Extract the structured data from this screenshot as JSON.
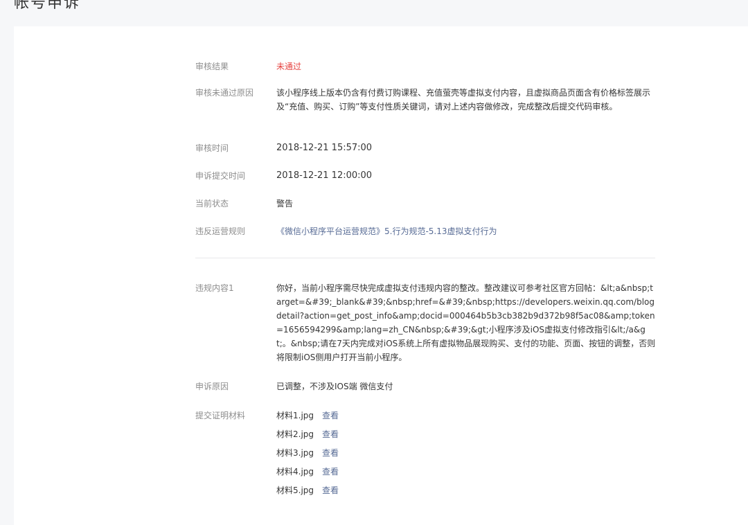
{
  "page": {
    "title": "帐号申诉"
  },
  "review": {
    "result": {
      "label": "审核结果",
      "value": "未通过"
    },
    "reason": {
      "label": "审核未通过原因",
      "value": "该小程序线上版本仍含有付费订购课程、充值萤壳等虚拟支付内容，且虚拟商品页面含有价格标签展示及“充值、购买、订购”等支付性质关键词，请对上述内容做修改，完成整改后提交代码审核。"
    },
    "review_time": {
      "label": "审核时间",
      "value": "2018-12-21 15:57:00"
    },
    "appeal_time": {
      "label": "申诉提交时间",
      "value": "2018-12-21 12:00:00"
    },
    "current_status": {
      "label": "当前状态",
      "value": "警告"
    },
    "violated_rule": {
      "label": "违反运营规则",
      "value": "《微信小程序平台运营规范》5.行为规范-5.13虚拟支付行为"
    }
  },
  "appeal": {
    "violation_content": {
      "label": "违规内容1",
      "value": "你好，当前小程序需尽快完成虚拟支付违规内容的整改。整改建议可参考社区官方回帖：&lt;a&nbsp;target=&#39;_blank&#39;&nbsp;href=&#39;&nbsp;https://developers.weixin.qq.com/blogdetail?action=get_post_info&amp;docid=000464b5b3cb382b9d372b98f5ac08&amp;token=1656594299&amp;lang=zh_CN&nbsp;&#39;&gt;小程序涉及iOS虚拟支付修改指引&lt;/a&gt;。&nbsp;请在7天内完成对iOS系统上所有虚拟物品展现购买、支付的功能、页面、按钮的调整，否则将限制iOS侧用户打开当前小程序。"
    },
    "appeal_reason": {
      "label": "申诉原因",
      "value": "已调整，不涉及IOS端 微信支付"
    },
    "materials": {
      "label": "提交证明材料",
      "view_label": "查看",
      "files": [
        "材料1.jpg",
        "材料2.jpg",
        "材料3.jpg",
        "材料4.jpg",
        "材料5.jpg"
      ]
    }
  },
  "colors": {
    "fail": "#e64340",
    "link": "#576b95",
    "label": "#8d8d8d"
  }
}
